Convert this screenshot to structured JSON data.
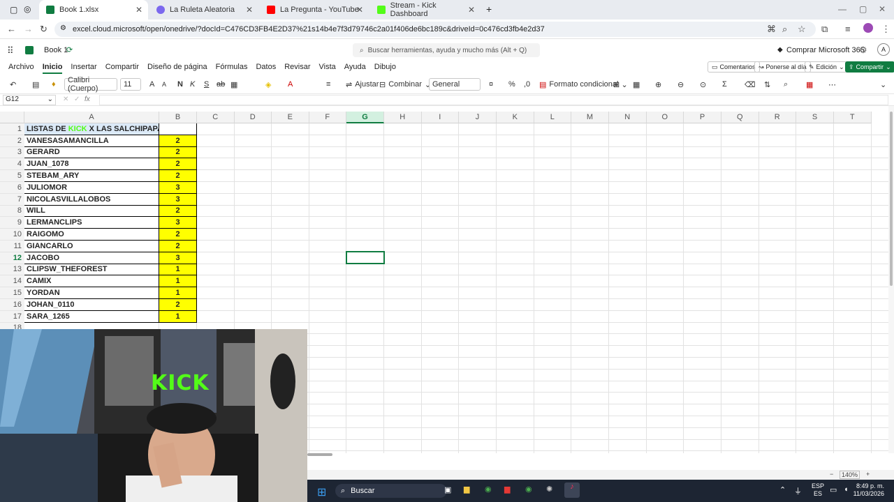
{
  "browser": {
    "tabs": [
      {
        "title": "Book 1.xlsx",
        "color": "#107c41"
      },
      {
        "title": "La Ruleta Aleatoria",
        "color": "#7b68ee"
      },
      {
        "title": "La Pregunta - YouTube",
        "color": "#ff0000"
      },
      {
        "title": "Stream - Kick Dashboard",
        "color": "#53fc18"
      }
    ],
    "new_tab": "+",
    "url": "excel.cloud.microsoft/open/onedrive/?docId=C476CD3FB4E2D37%21s14b4e7f3d79746c2a01f406de6bc189c&driveId=0c476cd3fb4e2d37"
  },
  "app": {
    "doc_title": "Book 1",
    "search_placeholder": "Buscar herramientas, ayuda y mucho más (Alt + Q)",
    "buy": "Comprar Microsoft 365",
    "avatar": "A"
  },
  "menu": {
    "items": [
      "Archivo",
      "Inicio",
      "Insertar",
      "Compartir",
      "Diseño de página",
      "Fórmulas",
      "Datos",
      "Revisar",
      "Vista",
      "Ayuda",
      "Dibujo"
    ],
    "comments": "Comentarios",
    "catchup": "Ponerse al día",
    "edit": "Edición",
    "share": "Compartir"
  },
  "toolbar": {
    "font": "Calibri (Cuerpo)",
    "size": "11",
    "wrap": "Ajustar",
    "merge": "Combinar",
    "number_format": "General",
    "conditional": "Formato condicional"
  },
  "formula": {
    "namebox": "G12",
    "fx": "fx"
  },
  "grid": {
    "columns": [
      "A",
      "B",
      "C",
      "D",
      "E",
      "F",
      "G",
      "H",
      "I",
      "J",
      "K",
      "L",
      "M",
      "N",
      "O",
      "P",
      "Q",
      "R",
      "S",
      "T"
    ],
    "title_pre": "LISTAS DE ",
    "title_kick": "KICK",
    "title_post": " X LAS SALCHIPAPAS:",
    "rows": [
      {
        "n": "2",
        "name": "VANESASAMANCILLA",
        "v": "2"
      },
      {
        "n": "3",
        "name": "GERARD",
        "v": "2"
      },
      {
        "n": "4",
        "name": "JUAN_1078",
        "v": "2"
      },
      {
        "n": "5",
        "name": "STEBAM_ARY",
        "v": "2"
      },
      {
        "n": "6",
        "name": "JULIOMOR",
        "v": "3"
      },
      {
        "n": "7",
        "name": "NICOLASVILLALOBOS",
        "v": "3"
      },
      {
        "n": "8",
        "name": "WILL",
        "v": "2"
      },
      {
        "n": "9",
        "name": "LERMANCLIPS",
        "v": "3"
      },
      {
        "n": "10",
        "name": "RAIGOMO",
        "v": "2"
      },
      {
        "n": "11",
        "name": "GIANCARLO",
        "v": "2"
      },
      {
        "n": "12",
        "name": "JACOBO",
        "v": "3"
      },
      {
        "n": "13",
        "name": "CLIPSW_THEFOREST",
        "v": "1"
      },
      {
        "n": "14",
        "name": "CAMIX",
        "v": "1"
      },
      {
        "n": "15",
        "name": "YORDAN",
        "v": "1"
      },
      {
        "n": "16",
        "name": "JOHAN_0110",
        "v": "2"
      },
      {
        "n": "17",
        "name": "SARA_1265",
        "v": "1"
      }
    ],
    "row18": "18"
  },
  "status": {
    "zoom": "140%"
  },
  "taskbar": {
    "search": "Buscar",
    "lang_top": "ESP",
    "lang_bottom": "ES",
    "time": "8:49 p. m.",
    "date": "11/03/2026"
  },
  "webcam": {
    "sign": "KICK"
  }
}
